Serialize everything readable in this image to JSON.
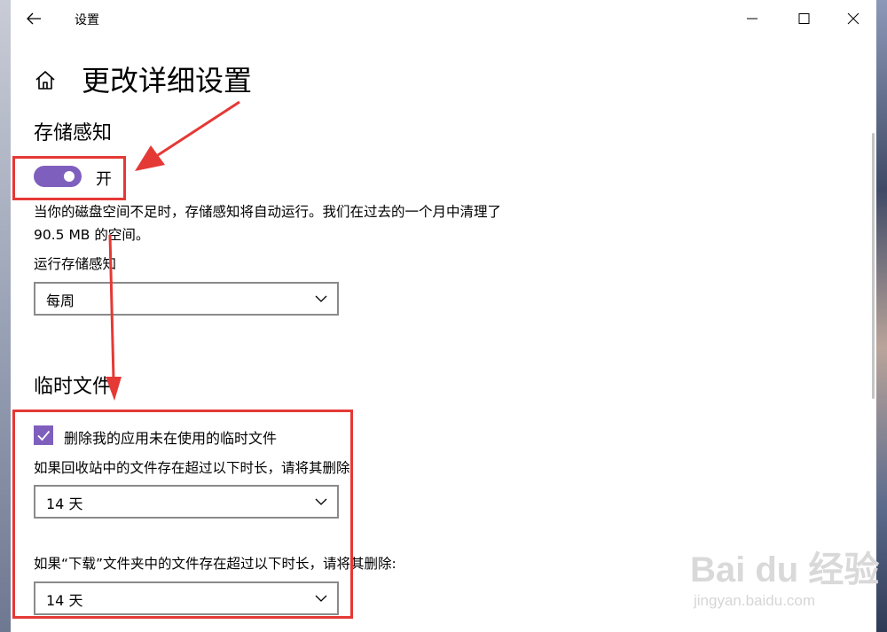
{
  "window": {
    "title": "设置",
    "controls": [
      "minimize-icon",
      "maximize-icon",
      "close-icon"
    ]
  },
  "page": {
    "title": "更改详细设置"
  },
  "storage_sense": {
    "heading": "存储感知",
    "toggle_state_label": "开",
    "toggle_on": true,
    "description": "当你的磁盘空间不足时，存储感知将自动运行。我们在过去的一个月中清理了 90.5 MB 的空间。",
    "run_label": "运行存储感知",
    "run_value": "每周"
  },
  "temp_files": {
    "heading": "临时文件",
    "checkbox_label": "删除我的应用未在使用的临时文件",
    "checkbox_checked": true,
    "recycle_label": "如果回收站中的文件存在超过以下时长，请将其删除:",
    "recycle_value": "14 天",
    "downloads_label": "如果“下载”文件夹中的文件存在超过以下时长，请将其删除:",
    "downloads_value": "14 天"
  },
  "watermark": {
    "logo": "Bai du 经验",
    "url": "jingyan.baidu.com"
  },
  "colors": {
    "accent": "#7f5fbd",
    "annotation": "#e53935"
  }
}
